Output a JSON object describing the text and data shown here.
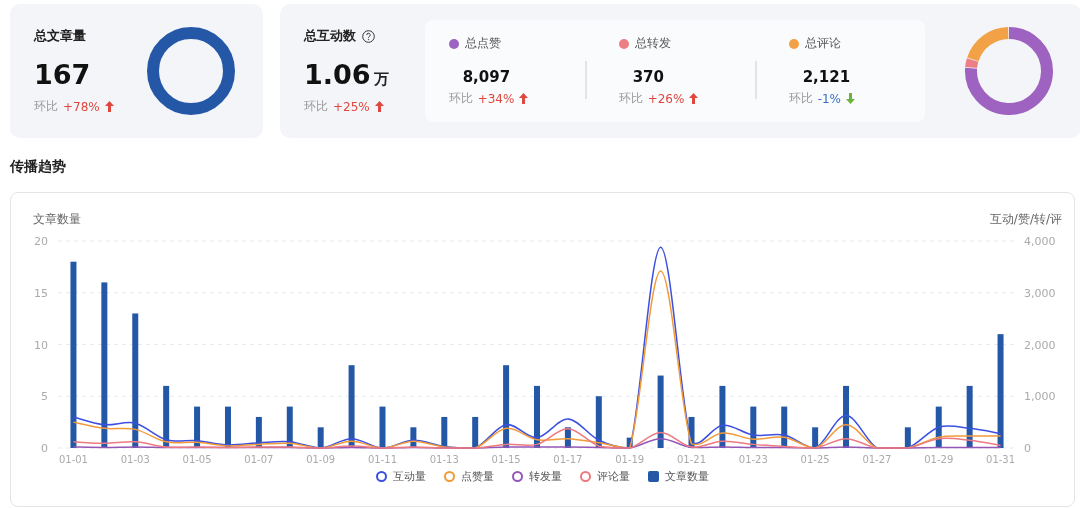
{
  "summary_cards": [
    {
      "title": "总文章量",
      "value": "167",
      "help": false,
      "change_label": "环比",
      "change": "+78%",
      "up": true,
      "color": "#2557a7"
    },
    {
      "title": "总互动数",
      "value": "1.06",
      "unit_suffix": "万",
      "help": true,
      "change_label": "环比",
      "change": "+25%",
      "up": true,
      "breakdown": [
        {
          "label": "总点赞",
          "color": "#9e62c0",
          "value": "8,097",
          "change_label": "环比",
          "change": "+34%",
          "up": true
        },
        {
          "label": "总转发",
          "color": "#ec7f86",
          "value": "370",
          "change_label": "环比",
          "change": "+26%",
          "up": true
        },
        {
          "label": "总评论",
          "color": "#f2a146",
          "value": "2,121",
          "change_label": "环比",
          "change": "-1%",
          "up": false
        }
      ]
    }
  ],
  "section_title": "传播趋势",
  "trend_chart": {
    "articles": {
      "chart_data": {
        "type": "bar",
        "ylabel": "文章数量",
        "grid": true,
        "categories": [
          null,
          null,
          null,
          null,
          null,
          null,
          null,
          null,
          null,
          null,
          null,
          null,
          null,
          null,
          null,
          null,
          null,
          null,
          null,
          null,
          null,
          null,
          null,
          null,
          null,
          null,
          null,
          null,
          null,
          null,
          null
        ],
        "ylim": [
          0,
          20
        ],
        "yticks": [
          0,
          5,
          10,
          15,
          20
        ],
        "series": [
          {
            "name": "文章数量",
            "color": "#2557a7",
            "values": [
              18,
              16,
              13,
              6,
              4,
              4,
              3,
              4,
              2,
              8,
              4,
              2,
              3,
              3,
              8,
              6,
              2,
              5,
              1,
              7,
              3,
              6,
              4,
              4,
              2,
              6,
              0,
              2,
              4,
              6,
              11
            ]
          }
        ]
      }
    },
    "interactions": {
      "chart_data": {
        "type": "line",
        "ylabel": "互动/赞/转/评",
        "categories": [
          "01-01",
          null,
          "01-03",
          null,
          "01-05",
          null,
          "01-07",
          null,
          "01-09",
          null,
          "01-11",
          null,
          "01-13",
          null,
          "01-15",
          null,
          "01-17",
          null,
          "01-19",
          null,
          "01-21",
          null,
          "01-23",
          null,
          "01-25",
          null,
          "01-27",
          null,
          "01-29",
          null,
          "01-31"
        ],
        "ylim": [
          0,
          4000
        ],
        "yticks": [
          {
            "value": 0,
            "label": "0"
          },
          {
            "value": 1000,
            "label": "1,000"
          },
          {
            "value": 2000,
            "label": "2,000"
          },
          {
            "value": 3000,
            "label": "3,000"
          },
          {
            "value": 4000,
            "label": "4,000"
          }
        ],
        "series": [
          {
            "name": "互动量",
            "color": "#3b4fe0",
            "values": [
              600,
              450,
              480,
              160,
              140,
              60,
              100,
              120,
              0,
              180,
              0,
              150,
              30,
              0,
              450,
              200,
              560,
              150,
              0,
              3880,
              100,
              440,
              250,
              250,
              0,
              630,
              0,
              0,
              400,
              380,
              280
            ]
          },
          {
            "name": "点赞量",
            "color": "#f29a38",
            "values": [
              500,
              380,
              360,
              120,
              110,
              40,
              70,
              90,
              0,
              130,
              0,
              130,
              20,
              0,
              380,
              160,
              180,
              100,
              0,
              3420,
              80,
              290,
              170,
              210,
              0,
              450,
              0,
              0,
              210,
              230,
              230
            ]
          },
          {
            "name": "转发量",
            "color": "#9457b5",
            "values": [
              20,
              10,
              20,
              10,
              10,
              10,
              10,
              10,
              0,
              10,
              0,
              10,
              0,
              0,
              20,
              20,
              20,
              10,
              0,
              180,
              10,
              20,
              10,
              10,
              0,
              20,
              0,
              0,
              10,
              10,
              10
            ]
          },
          {
            "name": "评论量",
            "color": "#ec7a80",
            "values": [
              120,
              90,
              120,
              20,
              20,
              10,
              20,
              20,
              0,
              40,
              0,
              20,
              0,
              0,
              70,
              70,
              370,
              40,
              0,
              300,
              20,
              130,
              70,
              30,
              0,
              180,
              0,
              0,
              180,
              150,
              50
            ]
          }
        ]
      }
    }
  }
}
